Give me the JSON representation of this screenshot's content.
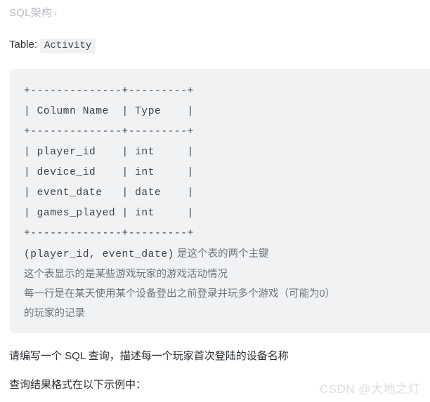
{
  "breadcrumb": {
    "label": "SQL架构",
    "separator": "›"
  },
  "table_label": {
    "prefix": "Table:",
    "table_name": "Activity"
  },
  "code_block": {
    "background_color": "#f1f2f4",
    "ascii_table": "+--------------+---------+\n| Column Name  | Type    |\n+--------------+---------+\n| player_id    | int     |\n| device_id    | int     |\n| event_date   | date    |\n| games_played | int     |\n+--------------+---------+",
    "notes": [
      {
        "mono_part": "(player_id, event_date)",
        "text_part": " 是这个表的两个主键"
      },
      {
        "mono_part": "",
        "text_part": "这个表显示的是某些游戏玩家的游戏活动情况"
      },
      {
        "mono_part": "",
        "text_part": "每一行是在某天使用某个设备登出之前登录并玩多个游戏（可能为0）"
      },
      {
        "mono_part": "",
        "text_part": "的玩家的记录"
      }
    ]
  },
  "paragraphs": {
    "question": "请编写一个 SQL 查询，描述每一个玩家首次登陆的设备名称",
    "format_note": "查询结果格式在以下示例中："
  },
  "watermark": {
    "text": "CSDN @大地之灯"
  }
}
